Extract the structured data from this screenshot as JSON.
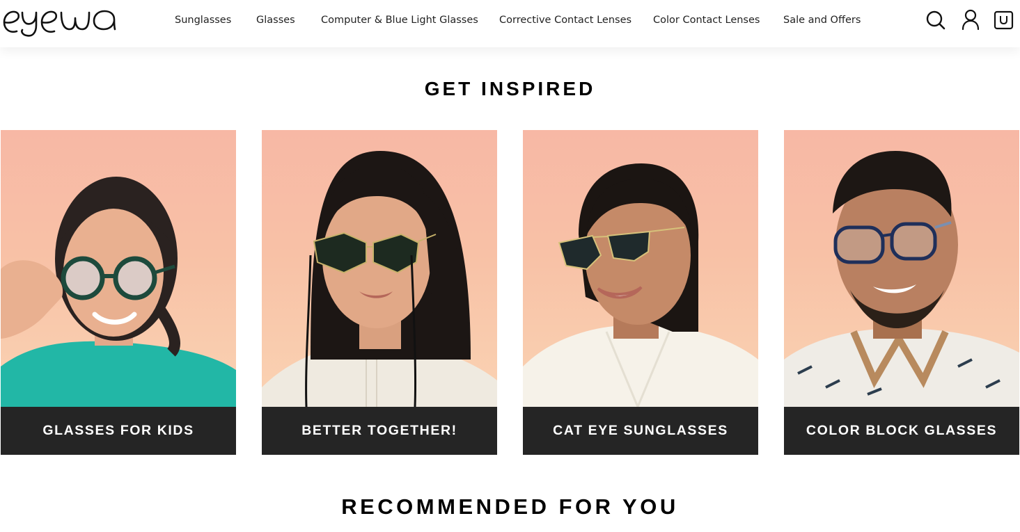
{
  "brand": {
    "logo_text": "eyewa",
    "logo_icon": "eyewa-wordmark"
  },
  "nav": {
    "items": [
      {
        "label": "Sunglasses"
      },
      {
        "label": "Glasses"
      },
      {
        "label": "Computer & Blue Light Glasses"
      },
      {
        "label": "Corrective Contact Lenses"
      },
      {
        "label": "Color Contact Lenses"
      },
      {
        "label": "Sale and Offers"
      }
    ]
  },
  "header_icons": {
    "search": "search-icon",
    "account": "user-icon",
    "cart": "shopping-bag-icon"
  },
  "sections": {
    "inspired_title": "GET INSPIRED",
    "recommended_title": "RECOMMENDED FOR YOU"
  },
  "cards": [
    {
      "label": "GLASSES FOR KIDS"
    },
    {
      "label": "BETTER TOGETHER!"
    },
    {
      "label": "CAT EYE SUNGLASSES"
    },
    {
      "label": "COLOR BLOCK GLASSES"
    }
  ],
  "colors": {
    "card_background": "#f8c1a6",
    "label_bar": "#252525",
    "label_text": "#ffffff"
  }
}
